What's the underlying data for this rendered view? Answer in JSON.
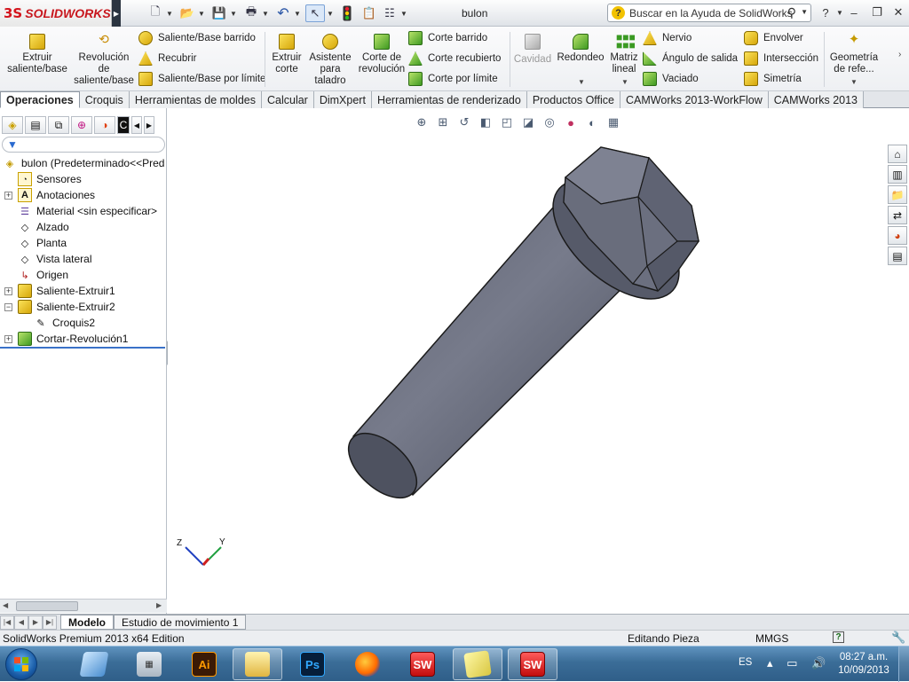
{
  "app": {
    "logo_prefix": "3S",
    "logo_text": "SOLIDWORKS",
    "document_title": "bulon",
    "search_placeholder": "Buscar en la Ayuda de SolidWorks"
  },
  "ribbon": {
    "extrude_boss": "Extruir saliente/base",
    "revolve_boss_l1": "Revolución",
    "revolve_boss_l2": "de",
    "revolve_boss_l3": "saliente/base",
    "swept_boss": "Saliente/Base barrido",
    "loft": "Recubrir",
    "boundary_boss": "Saliente/Base por límite",
    "extruded_cut_l1": "Extruir",
    "extruded_cut_l2": "corte",
    "hole_wizard_l1": "Asistente",
    "hole_wizard_l2": "para",
    "hole_wizard_l3": "taladro",
    "revolved_cut_l1": "Corte de",
    "revolved_cut_l2": "revolución",
    "swept_cut": "Corte barrido",
    "lofted_cut": "Corte recubierto",
    "boundary_cut": "Corte por límite",
    "cavity": "Cavidad",
    "fillet": "Redondeo",
    "linear_pattern_l1": "Matriz",
    "linear_pattern_l2": "lineal",
    "rib": "Nervio",
    "draft": "Ángulo de salida",
    "shell": "Vaciado",
    "wrap": "Envolver",
    "intersect": "Intersección",
    "mirror": "Simetría",
    "ref_geometry_l1": "Geometría",
    "ref_geometry_l2": "de refe..."
  },
  "tabs": [
    {
      "label": "Operaciones",
      "active": true
    },
    {
      "label": "Croquis"
    },
    {
      "label": "Herramientas de moldes"
    },
    {
      "label": "Calcular"
    },
    {
      "label": "DimXpert"
    },
    {
      "label": "Herramientas de renderizado"
    },
    {
      "label": "Productos Office"
    },
    {
      "label": "CAMWorks 2013-WorkFlow"
    },
    {
      "label": "CAMWorks 2013"
    }
  ],
  "tree": {
    "root": "bulon  (Predeterminado<<Pred",
    "items": [
      {
        "label": "Sensores"
      },
      {
        "label": "Anotaciones"
      },
      {
        "label": "Material <sin especificar>"
      },
      {
        "label": "Alzado"
      },
      {
        "label": "Planta"
      },
      {
        "label": "Vista lateral"
      },
      {
        "label": "Origen"
      },
      {
        "label": "Saliente-Extruir1"
      },
      {
        "label": "Saliente-Extruir2"
      },
      {
        "label": "Croquis2"
      },
      {
        "label": "Cortar-Revolución1"
      }
    ]
  },
  "triad": {
    "z": "Z",
    "y": "Y"
  },
  "bottom_tabs": {
    "model": "Modelo",
    "motion_study": "Estudio de movimiento 1"
  },
  "status": {
    "edition": "SolidWorks Premium 2013 x64 Edition",
    "editing": "Editando Pieza",
    "units": "MMGS",
    "help": "?"
  },
  "taskbar": {
    "illustrator_label": "Ai",
    "photoshop_label": "Ps",
    "sw_label": "SW",
    "language": "ES",
    "time": "08:27 a.m.",
    "date": "10/09/2013"
  },
  "colors": {
    "bolt_dark": "#3d4150",
    "bolt_mid": "#6e7282",
    "bolt_light": "#8a8e9e",
    "accent_red": "#d4141c",
    "taskbar": "#3b6d98"
  }
}
